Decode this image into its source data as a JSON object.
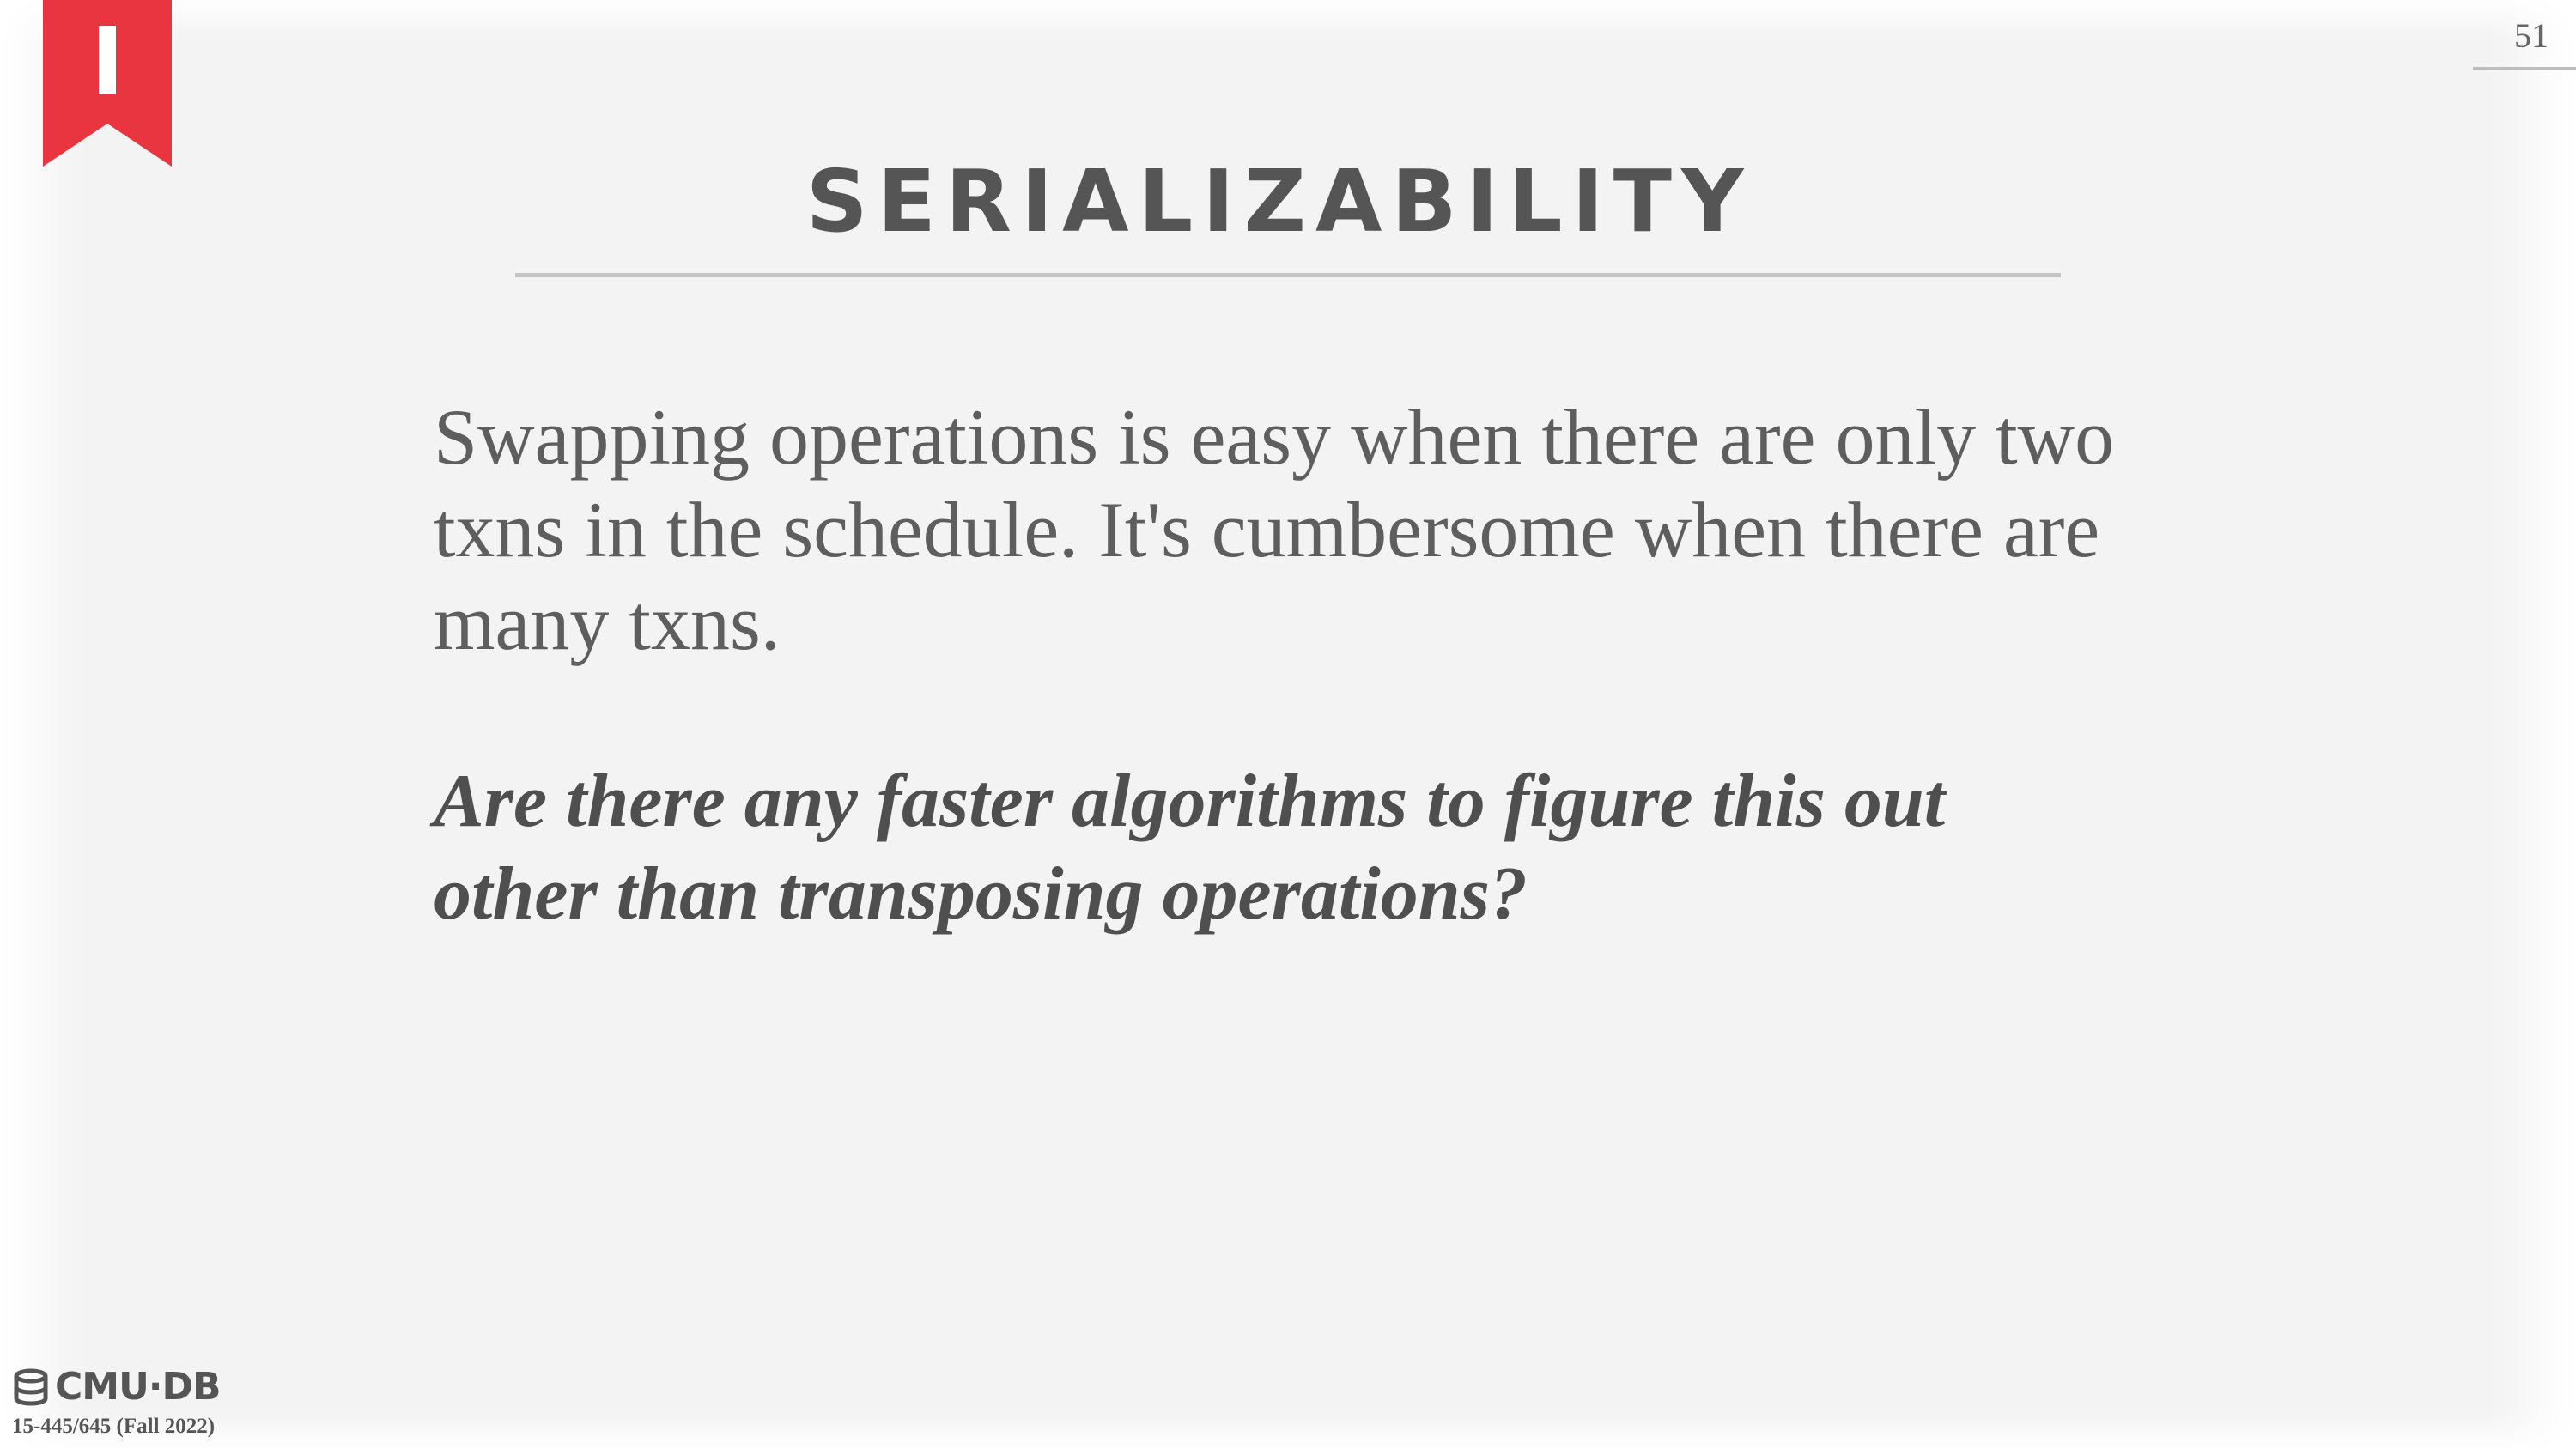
{
  "slide": {
    "number": "51",
    "title": "SERIALIZABILITY",
    "body": "Swapping operations is easy when there are only two txns in the schedule. It's cumbersome when there are many txns.",
    "question": "Are there any faster algorithms to figure this out other than transposing operations?"
  },
  "footer": {
    "logo_text": "CMU·DB",
    "course": "15-445/645 (Fall 2022)"
  },
  "colors": {
    "accent": "#e8353f",
    "title": "#555555",
    "body": "#5e5e5e",
    "background": "#f3f3f3"
  },
  "icons": {
    "bookmark": "bookmark-icon",
    "logo": "database-icon"
  }
}
